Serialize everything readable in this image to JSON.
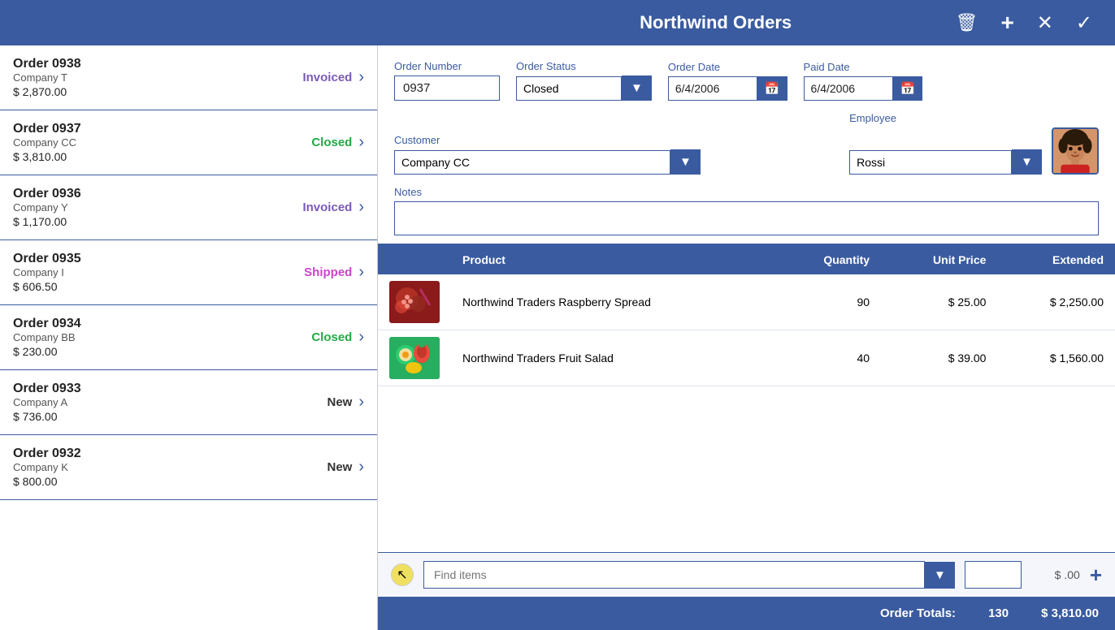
{
  "header": {
    "title": "Northwind Orders",
    "icons": {
      "delete": "🗑",
      "add": "+",
      "close": "✕",
      "confirm": "✓"
    }
  },
  "orders": [
    {
      "id": "0938",
      "company": "Company T",
      "amount": "$ 2,870.00",
      "status": "Invoiced",
      "statusClass": "status-invoiced"
    },
    {
      "id": "0937",
      "company": "Company CC",
      "amount": "$ 3,810.00",
      "status": "Closed",
      "statusClass": "status-closed"
    },
    {
      "id": "0936",
      "company": "Company Y",
      "amount": "$ 1,170.00",
      "status": "Invoiced",
      "statusClass": "status-invoiced"
    },
    {
      "id": "0935",
      "company": "Company I",
      "amount": "$ 606.50",
      "status": "Shipped",
      "statusClass": "status-shipped"
    },
    {
      "id": "0934",
      "company": "Company BB",
      "amount": "$ 230.00",
      "status": "Closed",
      "statusClass": "status-closed"
    },
    {
      "id": "0933",
      "company": "Company A",
      "amount": "$ 736.00",
      "status": "New",
      "statusClass": "status-new"
    },
    {
      "id": "0932",
      "company": "Company K",
      "amount": "$ 800.00",
      "status": "New",
      "statusClass": "status-new"
    }
  ],
  "detail": {
    "order_number_label": "Order Number",
    "order_number_value": "0937",
    "order_status_label": "Order Status",
    "order_status_value": "Closed",
    "order_date_label": "Order Date",
    "order_date_value": "6/4/2006",
    "paid_date_label": "Paid Date",
    "paid_date_value": "6/4/2006",
    "customer_label": "Customer",
    "customer_value": "Company CC",
    "employee_label": "Employee",
    "employee_value": "Rossi",
    "notes_label": "Notes",
    "notes_value": ""
  },
  "table": {
    "col_product": "Product",
    "col_quantity": "Quantity",
    "col_unit_price": "Unit Price",
    "col_extended": "Extended",
    "rows": [
      {
        "product": "Northwind Traders Raspberry Spread",
        "quantity": "90",
        "unit_price": "$ 25.00",
        "extended": "$ 2,250.00",
        "img_type": "raspberry"
      },
      {
        "product": "Northwind Traders Fruit Salad",
        "quantity": "40",
        "unit_price": "$ 39.00",
        "extended": "$ 1,560.00",
        "img_type": "fruit-salad"
      }
    ]
  },
  "bottom": {
    "find_placeholder": "Find items",
    "qty_value": "",
    "price_display": "$ .00",
    "add_btn": "+"
  },
  "totals": {
    "label": "Order Totals:",
    "quantity": "130",
    "amount": "$ 3,810.00"
  }
}
